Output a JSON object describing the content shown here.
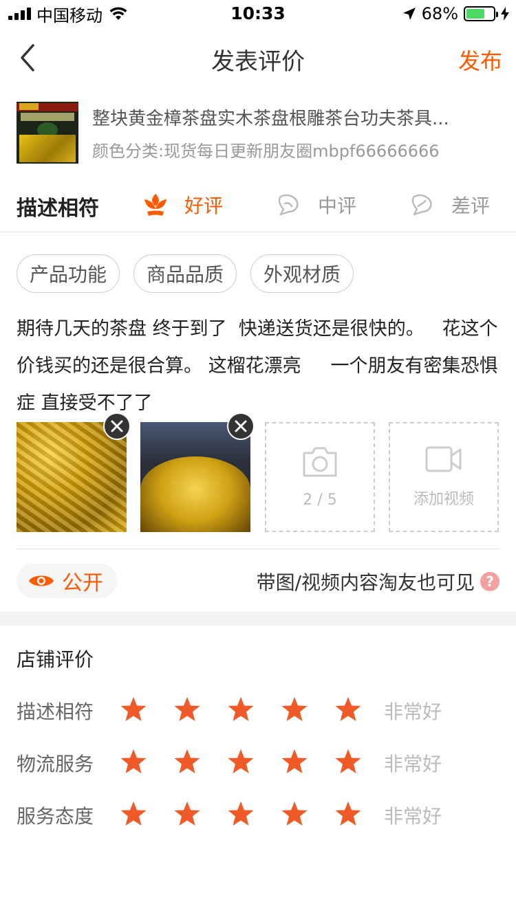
{
  "status_bar": {
    "carrier": "中国移动",
    "time": "10:33",
    "battery_percent": "68%",
    "battery_level": 0.68
  },
  "nav": {
    "title": "发表评价",
    "publish_label": "发布"
  },
  "product": {
    "title": "整块黄金樟茶盘实木茶盘根雕茶台功夫茶具...",
    "sku": "颜色分类:现货每日更新朋友圈mbpf66666666"
  },
  "rating": {
    "label": "描述相符",
    "options": [
      {
        "label": "好评",
        "icon": "flower-icon",
        "selected": true
      },
      {
        "label": "中评",
        "icon": "flower-outline-icon",
        "selected": false
      },
      {
        "label": "差评",
        "icon": "flower-outline-icon",
        "selected": false
      }
    ]
  },
  "tags": [
    "产品功能",
    "商品品质",
    "外观材质"
  ],
  "review": {
    "text": "期待几天的茶盘 终于到了  快递送货还是很快的。   花这个价钱买的还是很合算。 这榴花漂亮     一个朋友有密集恐惧症 直接受不了了"
  },
  "media": {
    "photo_count": "2 / 5",
    "add_video_label": "添加视频"
  },
  "privacy": {
    "public_label": "公开",
    "note": "带图/视频内容淘友也可见"
  },
  "shop_rating": {
    "title": "店铺评价",
    "rows": [
      {
        "label": "描述相符",
        "stars": 5,
        "desc": "非常好"
      },
      {
        "label": "物流服务",
        "stars": 5,
        "desc": "非常好"
      },
      {
        "label": "服务态度",
        "stars": 5,
        "desc": "非常好"
      }
    ]
  },
  "colors": {
    "accent": "#ff5a00",
    "star": "#f05a28"
  }
}
